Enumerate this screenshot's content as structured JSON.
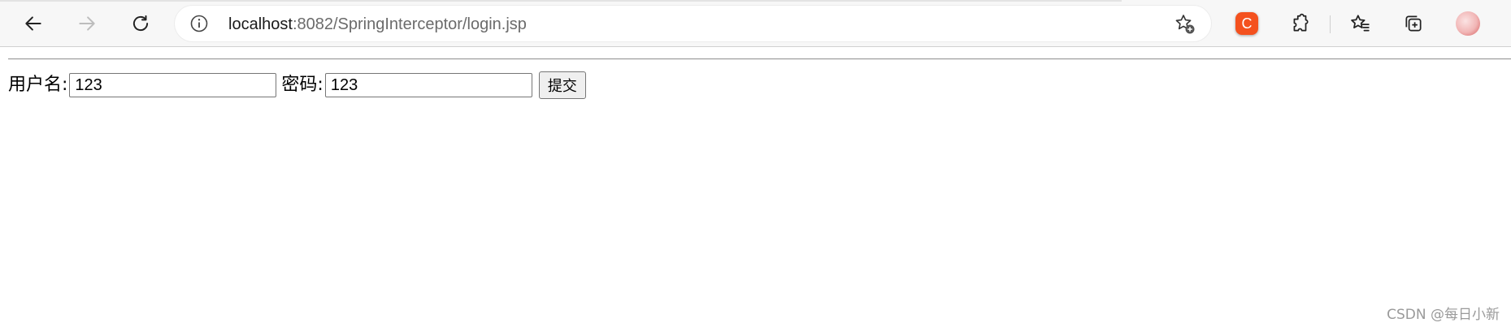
{
  "browser": {
    "url_host": "localhost",
    "url_rest": ":8082/SpringInterceptor/login.jsp",
    "extension_badge": "C",
    "icons": {
      "back": "back-arrow-icon",
      "forward": "forward-arrow-icon",
      "reload": "reload-icon",
      "site_info": "info-icon",
      "add_favorite": "star-add-icon",
      "extensions": "puzzle-icon",
      "favorites": "favorites-icon",
      "collections": "collections-icon",
      "profile": "avatar-icon"
    },
    "accent_color": "#f4511e"
  },
  "form": {
    "username_label": "用户名:",
    "username_value": "123",
    "password_label": "密码:",
    "password_value": "123",
    "submit_label": "提交"
  },
  "watermark": "CSDN @每日小新"
}
